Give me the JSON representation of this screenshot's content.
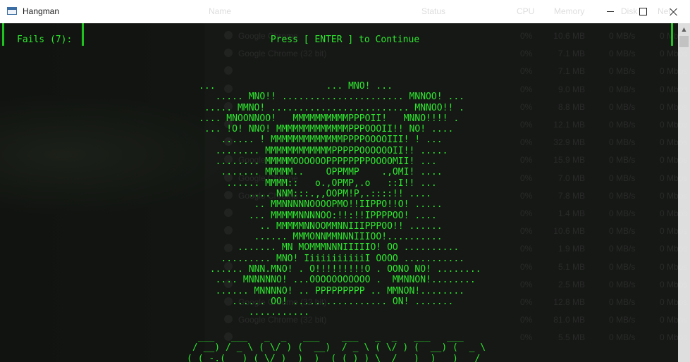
{
  "window": {
    "title": "Hangman",
    "controls": {
      "minimize": "minimize",
      "maximize": "maximize",
      "close": "close"
    }
  },
  "background_app": {
    "headers": [
      "Name",
      "Status",
      "CPU",
      "Memory",
      "Disk",
      "Net"
    ],
    "rows": [
      {
        "name": "Google Chrome",
        "cpu": "0%",
        "memory": "10.6 MB",
        "disk": "0 MB/s",
        "net": "0 Mbps"
      },
      {
        "name": "Google Chrome (32 bit)",
        "cpu": "0%",
        "memory": "7.1 MB",
        "disk": "0 MB/s",
        "net": "0 Mbps"
      },
      {
        "name": "",
        "cpu": "0%",
        "memory": "7.1 MB",
        "disk": "0 MB/s",
        "net": "0 Mbps"
      },
      {
        "name": "",
        "cpu": "0%",
        "memory": "9.0 MB",
        "disk": "0 MB/s",
        "net": "0 Mbps"
      },
      {
        "name": "",
        "cpu": "0%",
        "memory": "8.8 MB",
        "disk": "0 MB/s",
        "net": "0 Mbps"
      },
      {
        "name": "",
        "cpu": "0%",
        "memory": "12.1 MB",
        "disk": "0 MB/s",
        "net": "0 Mbps"
      },
      {
        "name": "",
        "cpu": "0%",
        "memory": "32.9 MB",
        "disk": "0 MB/s",
        "net": "0 Mbps"
      },
      {
        "name": "Google Chrome",
        "cpu": "0%",
        "memory": "15.9 MB",
        "disk": "0 MB/s",
        "net": "0 Mbps"
      },
      {
        "name": "Google Chrome",
        "cpu": "0%",
        "memory": "7.0 MB",
        "disk": "0 MB/s",
        "net": "0 Mbps"
      },
      {
        "name": "Google Chrome",
        "cpu": "0%",
        "memory": "7.8 MB",
        "disk": "0 MB/s",
        "net": "0 Mbps"
      },
      {
        "name": "",
        "cpu": "0%",
        "memory": "1.4 MB",
        "disk": "0 MB/s",
        "net": "0 Mbps"
      },
      {
        "name": "",
        "cpu": "0%",
        "memory": "10.6 MB",
        "disk": "0 MB/s",
        "net": "0 Mbps"
      },
      {
        "name": "",
        "cpu": "0%",
        "memory": "1.9 MB",
        "disk": "0 MB/s",
        "net": "0 Mbps"
      },
      {
        "name": "",
        "cpu": "0%",
        "memory": "5.1 MB",
        "disk": "0 MB/s",
        "net": "0 Mbps"
      },
      {
        "name": "",
        "cpu": "0%",
        "memory": "2.5 MB",
        "disk": "0 MB/s",
        "net": "0 Mbps"
      },
      {
        "name": "Google Chrome (32 bit)",
        "cpu": "0%",
        "memory": "12.8 MB",
        "disk": "0 MB/s",
        "net": "0 Mbps"
      },
      {
        "name": "Google Chrome (32 bit)",
        "cpu": "0%",
        "memory": "81.0 MB",
        "disk": "0 MB/s",
        "net": "0 Mbps"
      },
      {
        "name": "",
        "cpu": "0%",
        "memory": "5.5 MB",
        "disk": "0 MB/s",
        "net": "0 Mbps"
      }
    ]
  },
  "console": {
    "fails_label": "Fails (7):",
    "prompt": "Press [ ENTER ] to Continue",
    "skull_art": [
      "...                    ... MNO! ...",
      "   ..... MNO!! ...................... MNNOO! ...",
      " ..... MMNO! ......................... MNNOO!! .",
      ".... MNOONNOO!   MMMMMMMMMMPPPOII!   MNNO!!!! .",
      " ... !O! NNO! MMMMMMMMMMMMMPPPOOOII!! NO! ....",
      "    ...... ! MMMMMMMMMMMMMPPPPOOOOIII! ! ...",
      "   ........ MMMMMMMMMMMMPPPPPOOOOOOII!! .....",
      "   ........ MMMMMOOOOOOPPPPPPPPOOOOMII! ...",
      "    ....... MMMMM..    OPPMMP    .,OMI! ....",
      "     ...... MMMM::   o.,OPMP,.o   ::I!! ...",
      "         .... NNM:::.,,OOPM!P,.::::!! ....",
      "          .. MMNNNNNOOOOPMO!!IIPPO!!O! .....",
      "         ... MMMMMNNNNOO:!!:!!IPPPPOO! ....",
      "           .. MMMMMNNOOMMNNIIIPPPOO!! ......",
      "          ...... MMMONNMMNNNIIIOO!..........",
      "       ....... MN MOMMMNNNIIIIIO! OO ..........",
      "    ......... MNO! IiiiiiiiiiiI OOOO ...........",
      "  ...... NNN.MNO! . O!!!!!!!!!O . OONO NO! ........",
      "   .... MNNNNNO! ...OOOOOOOOOOO .  MMNNON!........",
      "   ...... MNNNNO! .. PPPPPPPPP .. MMNON!........",
      "      ...... OO! ................. ON! .......",
      "         ..........."
    ],
    "banner_art": [
      "  ___   ___   _  _   ___    ___   _  _   ___   ___",
      " / __) / _ \\ ( \\/ ) (  __)  / _ \\ ( \\/ ) (  __) (  _ \\",
      "( (_-.(___) ( \\/ )  ) _)  ( (_) ) \\  /   ) _)   )   /",
      " \\___/(_/\\_)(_/\\/\\_)(____)  \\___/   \\/   (____) (__\\_)"
    ]
  }
}
